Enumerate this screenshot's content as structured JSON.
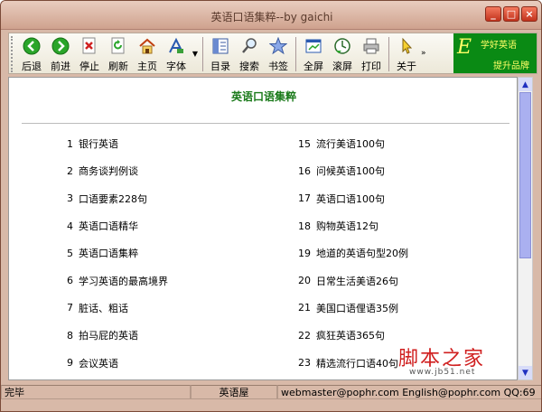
{
  "window": {
    "title": "英语口语集粹--by gaichi"
  },
  "toolbar": {
    "buttons": [
      {
        "label": "后退",
        "icon": "back-arrow-icon"
      },
      {
        "label": "前进",
        "icon": "forward-arrow-icon"
      },
      {
        "label": "停止",
        "icon": "stop-icon"
      },
      {
        "label": "刷新",
        "icon": "refresh-icon"
      },
      {
        "label": "主页",
        "icon": "home-icon"
      },
      {
        "label": "字体",
        "icon": "font-icon"
      },
      {
        "label": "目录",
        "icon": "contents-icon"
      },
      {
        "label": "搜索",
        "icon": "search-icon"
      },
      {
        "label": "书签",
        "icon": "bookmark-star-icon"
      },
      {
        "label": "全屏",
        "icon": "fullscreen-icon"
      },
      {
        "label": "滚屏",
        "icon": "autoscroll-icon"
      },
      {
        "label": "打印",
        "icon": "print-icon"
      },
      {
        "label": "关于",
        "icon": "about-pointer-icon"
      }
    ],
    "logo": {
      "line1": "学好英语",
      "line2": "提升品牌"
    }
  },
  "content": {
    "heading": "英语口语集粹",
    "left_items": [
      {
        "num": "1",
        "text": "银行英语"
      },
      {
        "num": "2",
        "text": "商务谈判例谈"
      },
      {
        "num": "3",
        "text": "口语要素228句"
      },
      {
        "num": "4",
        "text": "英语口语精华"
      },
      {
        "num": "5",
        "text": "英语口语集粹"
      },
      {
        "num": "6",
        "text": "学习英语的最高境界"
      },
      {
        "num": "7",
        "text": "脏话、粗话"
      },
      {
        "num": "8",
        "text": "拍马屁的英语"
      },
      {
        "num": "9",
        "text": "会议英语"
      }
    ],
    "right_items": [
      {
        "num": "15",
        "text": "流行美语100句"
      },
      {
        "num": "16",
        "text": "问候英语100句"
      },
      {
        "num": "17",
        "text": "英语口语100句"
      },
      {
        "num": "18",
        "text": "购物英语12句"
      },
      {
        "num": "19",
        "text": "地道的英语句型20例"
      },
      {
        "num": "20",
        "text": "日常生活美语26句"
      },
      {
        "num": "21",
        "text": "美国口语俚语35例"
      },
      {
        "num": "22",
        "text": "疯狂英语365句"
      },
      {
        "num": "23",
        "text": "精选流行口语40句"
      }
    ]
  },
  "watermark": {
    "text": "脚本之家",
    "url": "www.jb51.net"
  },
  "statusbar": {
    "status": "完毕",
    "center": "英语屋",
    "contact": "webmaster@pophr.com English@pophr.com QQ:69"
  },
  "colors": {
    "heading": "#1a7a1a",
    "frame": "#d8b9a8",
    "scroll_thumb": "#aab0f0"
  }
}
